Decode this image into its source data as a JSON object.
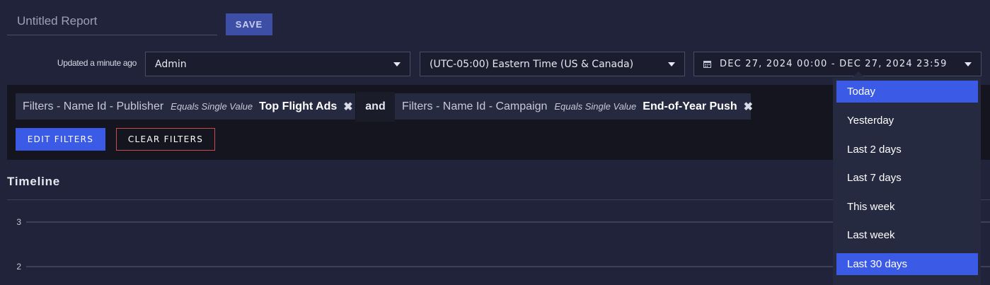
{
  "report": {
    "title_placeholder": "Untitled Report",
    "save_label": "SAVE",
    "updated_text": "Updated a minute ago"
  },
  "selectors": {
    "user": "Admin",
    "timezone": "(UTC-05:00) Eastern Time (US & Canada)",
    "date_range": "DEC 27, 2024 00:00 - DEC 27, 2024 23:59"
  },
  "filters": {
    "items": [
      {
        "field": "Filters - Name Id - Publisher",
        "operator": "Equals Single Value",
        "value": "Top Flight Ads"
      },
      {
        "field": "Filters - Name Id - Campaign",
        "operator": "Equals Single Value",
        "value": "End-of-Year Push"
      }
    ],
    "conjunction": "and",
    "edit_label": "EDIT FILTERS",
    "clear_label": "CLEAR FILTERS"
  },
  "timeline": {
    "title": "Timeline"
  },
  "chart_data": {
    "type": "line",
    "title": "Timeline",
    "y_ticks": [
      "3",
      "2"
    ],
    "series": []
  },
  "date_presets": {
    "options": [
      "Today",
      "Yesterday",
      "Last 2 days",
      "Last 7 days",
      "This week",
      "Last week",
      "Last 30 days"
    ],
    "selected": "Today",
    "hovered": "Last 30 days"
  },
  "colors": {
    "background": "#21233a",
    "accent": "#3b5be6",
    "danger_border": "#c94a52"
  }
}
